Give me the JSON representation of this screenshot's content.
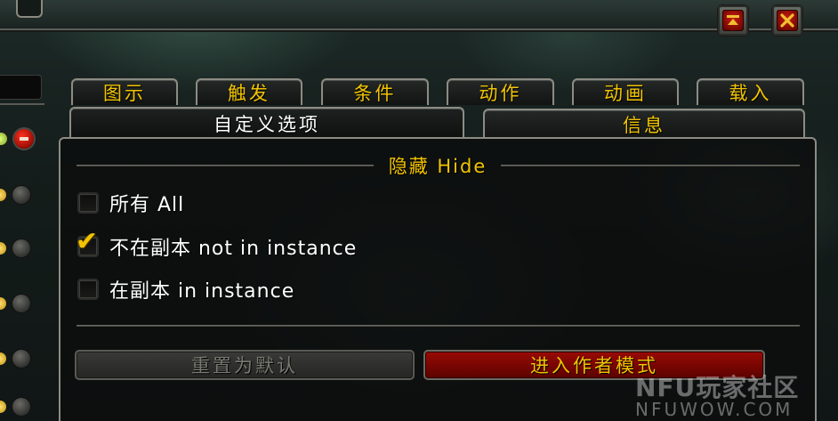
{
  "window": {
    "collapse_icon": "collapse-icon",
    "close_icon": "close-icon"
  },
  "tabs_row1": [
    {
      "label": "图示"
    },
    {
      "label": "触发"
    },
    {
      "label": "条件"
    },
    {
      "label": "动作"
    },
    {
      "label": "动画"
    },
    {
      "label": "载入"
    }
  ],
  "tabs_row2": [
    {
      "label": "自定义选项",
      "active": true
    },
    {
      "label": "信息",
      "active": false
    }
  ],
  "hide_section": {
    "header": "隐藏 Hide",
    "options": [
      {
        "label": "所有 All",
        "checked": false
      },
      {
        "label": "不在副本 not in instance",
        "checked": true
      },
      {
        "label": "在副本 in instance",
        "checked": false
      }
    ]
  },
  "buttons": {
    "reset": "重置为默认",
    "author_mode": "进入作者模式"
  },
  "watermark": {
    "line1": "NFU玩家社区",
    "line2": "NFUWOW.COM"
  },
  "colors": {
    "gold_text": "#f2c400",
    "white_text": "#ffffff",
    "author_button": "#8a0804",
    "border": "#8c8c84"
  }
}
